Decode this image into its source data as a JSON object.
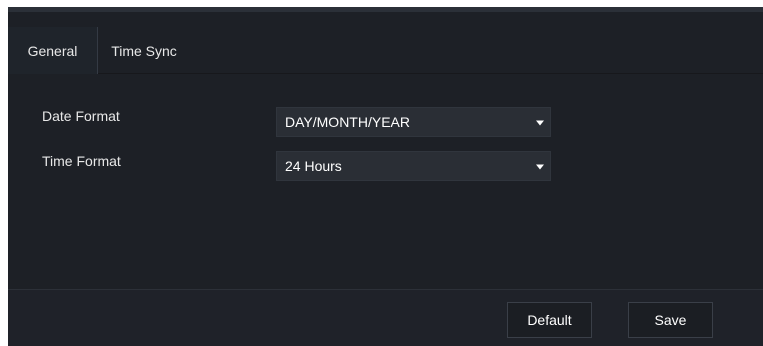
{
  "tabs": [
    {
      "label": "General",
      "active": true
    },
    {
      "label": "Time Sync",
      "active": false
    }
  ],
  "form": {
    "date_format": {
      "label": "Date Format",
      "value": "DAY/MONTH/YEAR"
    },
    "time_format": {
      "label": "Time Format",
      "value": "24 Hours"
    }
  },
  "footer": {
    "default_label": "Default",
    "save_label": "Save"
  },
  "colors": {
    "background": "#1d2026",
    "panel": "#2a2e35",
    "text": "#e8e8e8"
  }
}
